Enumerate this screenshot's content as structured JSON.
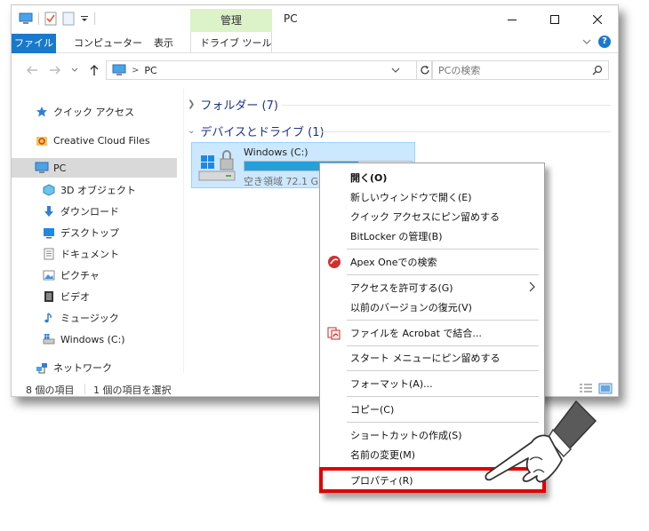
{
  "titlebar": {
    "manage_tab": "管理",
    "title": "PC"
  },
  "ribbon": {
    "tabs": [
      "ファイル",
      "コンピューター",
      "表示",
      "ドライブ ツール"
    ],
    "help_label": "?"
  },
  "address": {
    "crumb": "PC",
    "separator": ">",
    "search_placeholder": "PCの検索"
  },
  "nav": {
    "items": [
      {
        "label": "クイック アクセス",
        "icon": "star-icon"
      },
      {
        "label": "Creative Cloud Files",
        "icon": "creative-cloud-icon"
      },
      {
        "label": "PC",
        "icon": "computer-icon",
        "selected": true
      },
      {
        "label": "3D オブジェクト",
        "icon": "cube-icon"
      },
      {
        "label": "ダウンロード",
        "icon": "download-icon"
      },
      {
        "label": "デスクトップ",
        "icon": "desktop-icon"
      },
      {
        "label": "ドキュメント",
        "icon": "document-icon"
      },
      {
        "label": "ピクチャ",
        "icon": "picture-icon"
      },
      {
        "label": "ビデオ",
        "icon": "video-icon"
      },
      {
        "label": "ミュージック",
        "icon": "music-icon"
      },
      {
        "label": "Windows (C:)",
        "icon": "drive-icon"
      },
      {
        "label": "ネットワーク",
        "icon": "network-icon"
      }
    ]
  },
  "content": {
    "folders_group": "フォルダー (7)",
    "devices_group": "デバイスとドライブ (1)",
    "drive": {
      "name": "Windows (C:)",
      "free_text": "空き領域 72.1 GB",
      "used_fraction": 0.68
    }
  },
  "status": {
    "count": "8 個の項目",
    "selected": "1 個の項目を選択"
  },
  "context_menu": {
    "open": "開く(O)",
    "open_new_window": "新しいウィンドウで開く(E)",
    "pin_quick_access": "クイック アクセスにピン留めする",
    "bitlocker": "BitLocker の管理(B)",
    "apex_one": "Apex Oneでの検索",
    "give_access": "アクセスを許可する(G)",
    "restore_versions": "以前のバージョンの復元(V)",
    "acrobat": "ファイルを Acrobat で結合...",
    "pin_start": "スタート メニューにピン留めする",
    "format": "フォーマット(A)...",
    "copy": "コピー(C)",
    "create_shortcut": "ショートカットの作成(S)",
    "rename": "名前の変更(M)",
    "properties": "プロパティ(R)"
  },
  "colors": {
    "accent": "#1979ca",
    "selection": "#cce8ff",
    "highlight": "#e00000",
    "manage_tab": "#dcf2c9"
  }
}
